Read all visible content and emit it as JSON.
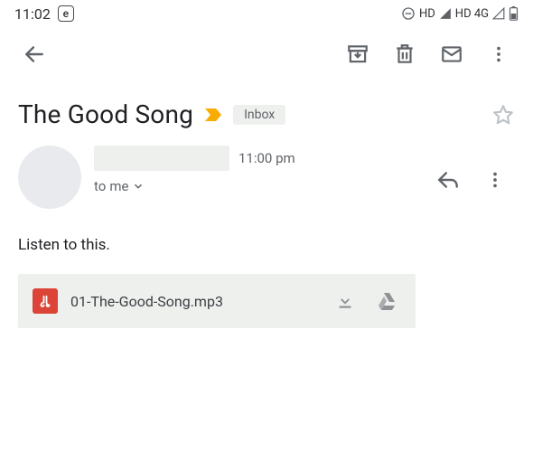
{
  "status": {
    "time": "11:02",
    "badge": "e",
    "right_items": [
      "HD",
      "HD 4G"
    ]
  },
  "toolbar": {
    "back_icon": "back-arrow",
    "archive_icon": "archive",
    "delete_icon": "delete",
    "mail_icon": "mark-unread",
    "more_icon": "more"
  },
  "email": {
    "subject": "The Good Song",
    "label": "Inbox",
    "time": "11:00 pm",
    "to_line_prefix": "to ",
    "to_line_name": "me",
    "body": "Listen to this."
  },
  "attachment": {
    "filename": "01-The-Good-Song.mp3",
    "type": "audio"
  }
}
